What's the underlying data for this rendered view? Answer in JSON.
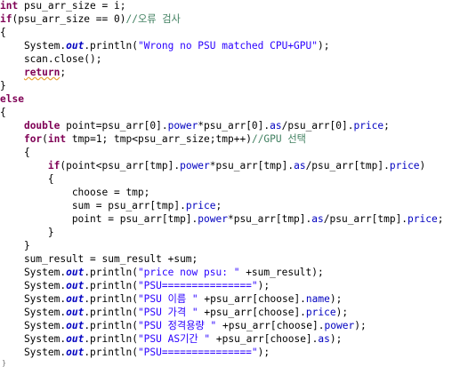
{
  "colors": {
    "background": "#ffffff",
    "keyword": "#7f0055",
    "field": "#0000c0",
    "string": "#2a00ff",
    "comment": "#3f7f5f",
    "plain": "#000000",
    "warning_underline": "#e8a030"
  },
  "code": {
    "lines": [
      [
        [
          "kw",
          "int"
        ],
        [
          "p",
          " psu_arr_size = i;"
        ]
      ],
      [
        [
          "kw",
          "if"
        ],
        [
          "p",
          "(psu_arr_size == 0)"
        ],
        [
          "cmt",
          "//오류 검사"
        ]
      ],
      [
        [
          "p",
          "{"
        ]
      ],
      [
        [
          "p",
          "    System."
        ],
        [
          "sfld",
          "out"
        ],
        [
          "p",
          ".println("
        ],
        [
          "str",
          "\"Wrong no PSU matched CPU+GPU\""
        ],
        [
          "p",
          ");"
        ]
      ],
      [
        [
          "p",
          "    scan.close();"
        ]
      ],
      [
        [
          "p",
          "    "
        ],
        [
          "kwsq",
          "return"
        ],
        [
          "p",
          ";"
        ]
      ],
      [
        [
          "p",
          "}"
        ]
      ],
      [
        [
          "kw",
          "else"
        ]
      ],
      [
        [
          "p",
          "{"
        ]
      ],
      [
        [
          "p",
          "    "
        ],
        [
          "kw",
          "double"
        ],
        [
          "p",
          " point=psu_arr[0]."
        ],
        [
          "fld",
          "power"
        ],
        [
          "p",
          "*psu_arr[0]."
        ],
        [
          "fld",
          "as"
        ],
        [
          "p",
          "/psu_arr[0]."
        ],
        [
          "fld",
          "price"
        ],
        [
          "p",
          ";"
        ]
      ],
      [
        [
          "p",
          "    "
        ],
        [
          "kw",
          "for"
        ],
        [
          "p",
          "("
        ],
        [
          "kw",
          "int"
        ],
        [
          "p",
          " tmp=1; tmp<psu_arr_size;tmp++)"
        ],
        [
          "cmt",
          "//GPU 선택"
        ]
      ],
      [
        [
          "p",
          "    {"
        ]
      ],
      [
        [
          "p",
          "        "
        ],
        [
          "kw",
          "if"
        ],
        [
          "p",
          "(point<psu_arr[tmp]."
        ],
        [
          "fld",
          "power"
        ],
        [
          "p",
          "*psu_arr[tmp]."
        ],
        [
          "fld",
          "as"
        ],
        [
          "p",
          "/psu_arr[tmp]."
        ],
        [
          "fld",
          "price"
        ],
        [
          "p",
          ")"
        ]
      ],
      [
        [
          "p",
          "        {"
        ]
      ],
      [
        [
          "p",
          "            choose = tmp;"
        ]
      ],
      [
        [
          "p",
          "            sum = psu_arr[tmp]."
        ],
        [
          "fld",
          "price"
        ],
        [
          "p",
          ";"
        ]
      ],
      [
        [
          "p",
          "            point = psu_arr[tmp]."
        ],
        [
          "fld",
          "power"
        ],
        [
          "p",
          "*psu_arr[tmp]."
        ],
        [
          "fld",
          "as"
        ],
        [
          "p",
          "/psu_arr[tmp]."
        ],
        [
          "fld",
          "price"
        ],
        [
          "p",
          ";"
        ]
      ],
      [
        [
          "p",
          "        }"
        ]
      ],
      [
        [
          "p",
          "    }"
        ]
      ],
      [
        [
          "p",
          "    sum_result = sum_result +sum;"
        ]
      ],
      [
        [
          "p",
          "    System."
        ],
        [
          "sfld",
          "out"
        ],
        [
          "p",
          ".println("
        ],
        [
          "str",
          "\"price now psu: \""
        ],
        [
          "p",
          " +sum_result);"
        ]
      ],
      [
        [
          "p",
          "    System."
        ],
        [
          "sfld",
          "out"
        ],
        [
          "p",
          ".println("
        ],
        [
          "str",
          "\"PSU===============\""
        ],
        [
          "p",
          ");"
        ]
      ],
      [
        [
          "p",
          "    System."
        ],
        [
          "sfld",
          "out"
        ],
        [
          "p",
          ".println("
        ],
        [
          "str",
          "\"PSU 이름 \""
        ],
        [
          "p",
          " +psu_arr[choose]."
        ],
        [
          "fld",
          "name"
        ],
        [
          "p",
          ");"
        ]
      ],
      [
        [
          "p",
          "    System."
        ],
        [
          "sfld",
          "out"
        ],
        [
          "p",
          ".println("
        ],
        [
          "str",
          "\"PSU 가격 \""
        ],
        [
          "p",
          " +psu_arr[choose]."
        ],
        [
          "fld",
          "price"
        ],
        [
          "p",
          ");"
        ]
      ],
      [
        [
          "p",
          "    System."
        ],
        [
          "sfld",
          "out"
        ],
        [
          "p",
          ".println("
        ],
        [
          "str",
          "\"PSU 정격용량 \""
        ],
        [
          "p",
          " +psu_arr[choose]."
        ],
        [
          "fld",
          "power"
        ],
        [
          "p",
          ");"
        ]
      ],
      [
        [
          "p",
          "    System."
        ],
        [
          "sfld",
          "out"
        ],
        [
          "p",
          ".println("
        ],
        [
          "str",
          "\"PSU AS기간 \""
        ],
        [
          "p",
          " +psu_arr[choose]."
        ],
        [
          "fld",
          "as"
        ],
        [
          "p",
          ");"
        ]
      ],
      [
        [
          "p",
          "    System."
        ],
        [
          "sfld",
          "out"
        ],
        [
          "p",
          ".println("
        ],
        [
          "str",
          "\"PSU===============\""
        ],
        [
          "p",
          ");"
        ]
      ]
    ],
    "fold_marker": "}"
  }
}
